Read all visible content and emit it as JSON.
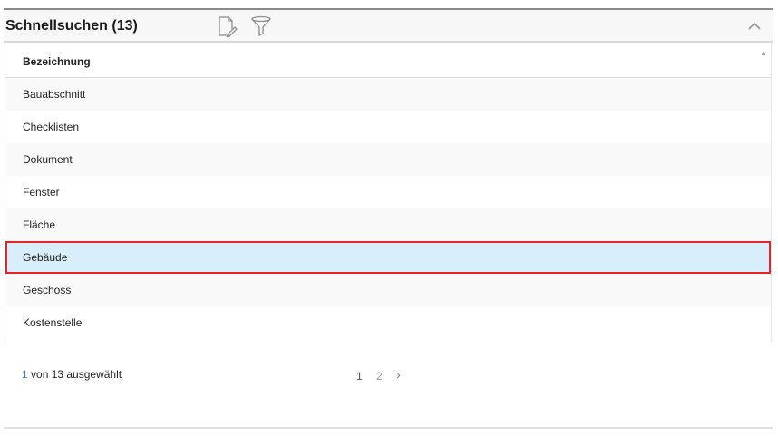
{
  "panel": {
    "title": "Schnellsuchen (13)",
    "icons": [
      "document-edit-icon",
      "filter-icon",
      "chevron-up-icon"
    ]
  },
  "grid": {
    "column_header": "Bezeichnung",
    "rows": [
      {
        "label": "Bauabschnitt",
        "selected": false
      },
      {
        "label": "Checklisten",
        "selected": false
      },
      {
        "label": "Dokument",
        "selected": false
      },
      {
        "label": "Fenster",
        "selected": false
      },
      {
        "label": "Fläche",
        "selected": false
      },
      {
        "label": "Gebäude",
        "selected": true
      },
      {
        "label": "Geschoss",
        "selected": false
      },
      {
        "label": "Kostenstelle",
        "selected": false
      }
    ]
  },
  "footer": {
    "selected_count": "1",
    "status_rest": " von 13 ausgewählt",
    "pages": [
      "1",
      "2"
    ],
    "next": "›"
  },
  "colors": {
    "selected_row_bg": "#d8eefa",
    "selected_row_border": "#e2232a",
    "selected_count_color": "#3b78d8"
  }
}
